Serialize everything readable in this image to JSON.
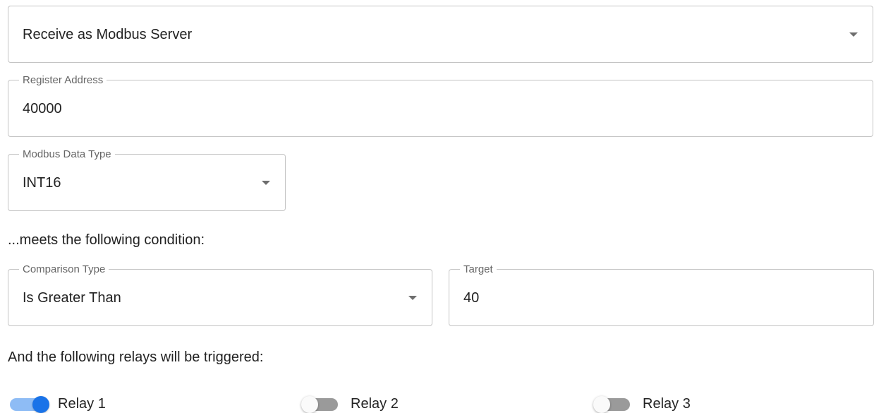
{
  "trigger_mode": {
    "value": "Receive as Modbus Server"
  },
  "register_address": {
    "label": "Register Address",
    "value": "40000"
  },
  "modbus_data_type": {
    "label": "Modbus Data Type",
    "value": "INT16"
  },
  "condition_heading": "...meets the following condition:",
  "comparison_type": {
    "label": "Comparison Type",
    "value": "Is Greater Than"
  },
  "target": {
    "label": "Target",
    "value": "40"
  },
  "relays_heading": "And the following relays will be triggered:",
  "relays": [
    {
      "label": "Relay 1",
      "checked": true
    },
    {
      "label": "Relay 2",
      "checked": false
    },
    {
      "label": "Relay 3",
      "checked": false
    }
  ],
  "colors": {
    "accent": "#1a73e8",
    "accent_track": "#8ebcf5",
    "border": "#c4c4c4"
  }
}
